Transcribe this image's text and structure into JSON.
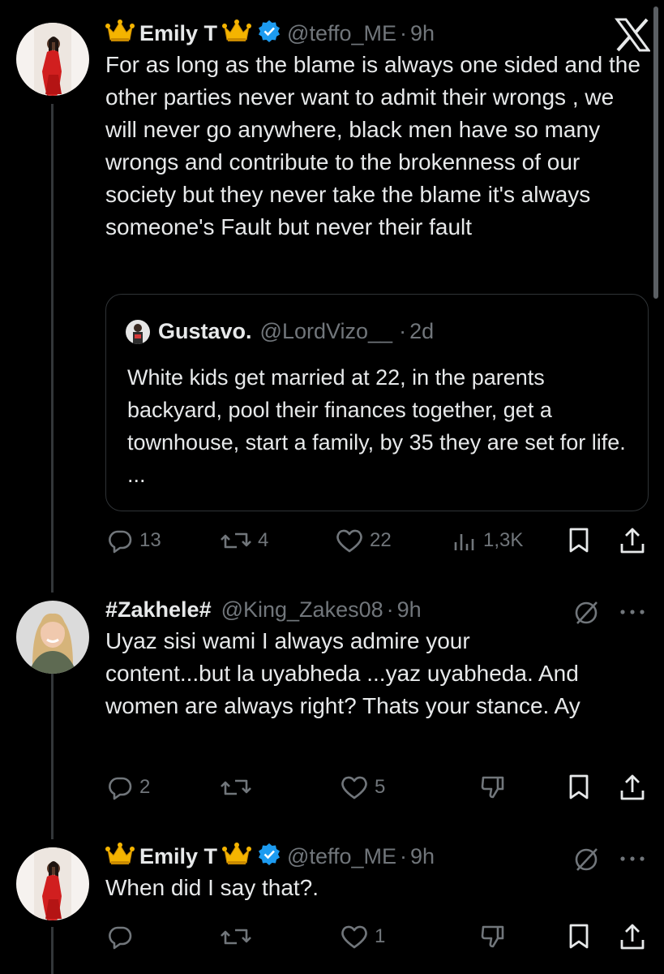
{
  "tweet_main": {
    "name": "Emily T",
    "handle": "@teffo_ME",
    "dot": "·",
    "time": "9h",
    "body": "For as long as the blame is always one sided and the other parties never want to admit their wrongs , we will never go anywhere, black men have so many wrongs and contribute to the brokenness of our society but they never take the blame it's always someone's Fault but never their fault",
    "quote": {
      "name": "Gustavo.",
      "handle": "@LordVizo__",
      "dot": "·",
      "time": "2d",
      "body": "White kids get married at 22, in the parents backyard, pool their finances together, get a townhouse, start a family, by 35 they are set for life. ..."
    },
    "replies": "13",
    "reposts": "4",
    "likes": "22",
    "views": "1,3K"
  },
  "reply_1": {
    "name": "#Zakhele#",
    "handle": "@King_Zakes08",
    "dot": "·",
    "time": "9h",
    "body": "Uyaz sisi wami I always admire your content...but la uyabheda ...yaz uyabheda. And women are always right? Thats your stance. Ay",
    "replies": "2",
    "likes": "5"
  },
  "reply_2": {
    "name": "Emily T",
    "handle": "@teffo_ME",
    "dot": "·",
    "time": "9h",
    "body": "When did I say that?.",
    "likes": "1"
  },
  "colors": {
    "background": "#000000",
    "text": "#e7e9ea",
    "muted": "#71767b",
    "verified": "#1d9bf0",
    "border": "#2f3336"
  }
}
